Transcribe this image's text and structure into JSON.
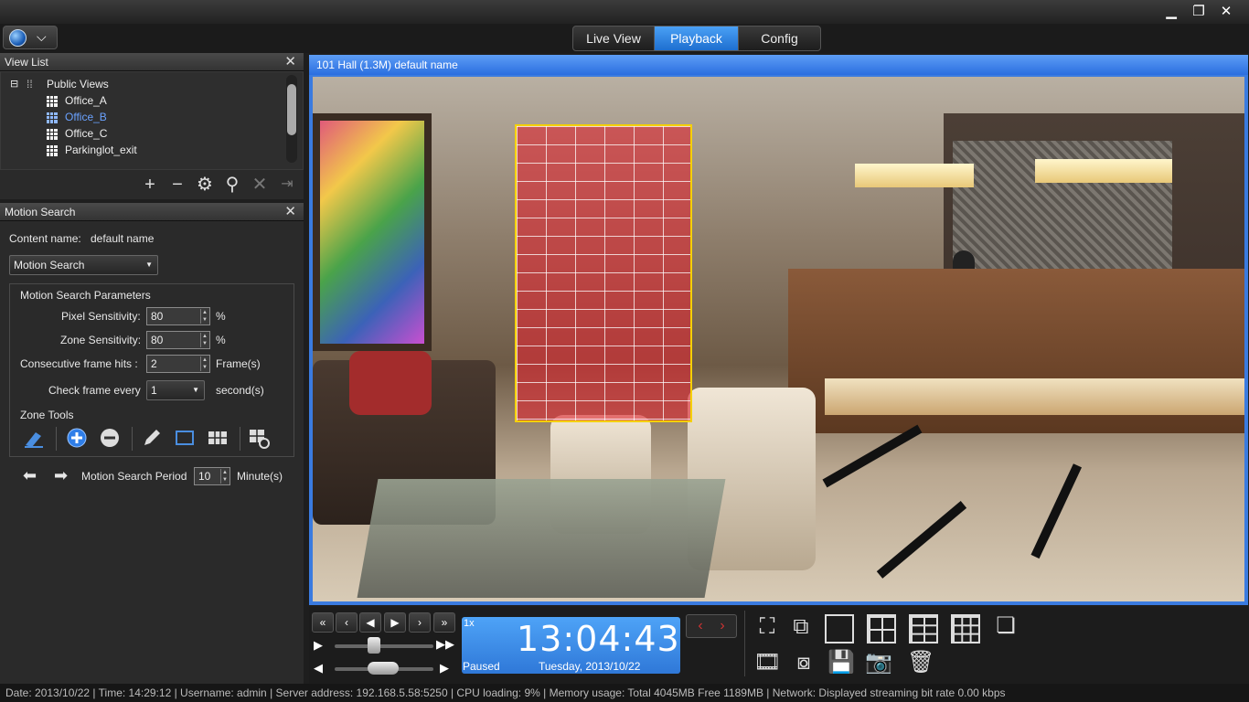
{
  "window": {
    "minimize": "▁",
    "restore": "❐",
    "close": "✕"
  },
  "tabs": [
    {
      "label": "Live View"
    },
    {
      "label": "Playback"
    },
    {
      "label": "Config"
    }
  ],
  "view_list": {
    "title": "View List",
    "root": "Public Views",
    "items": [
      "Office_A",
      "Office_B",
      "Office_C",
      "Parkinglot_exit"
    ],
    "selected": "Office_B"
  },
  "motion_search": {
    "title": "Motion Search",
    "content_name_label": "Content name:",
    "content_name_value": "default name",
    "mode": "Motion Search",
    "params_title": "Motion Search Parameters",
    "pixel_sensitivity_label": "Pixel Sensitivity:",
    "pixel_sensitivity": "80",
    "zone_sensitivity_label": "Zone Sensitivity:",
    "zone_sensitivity": "80",
    "percent": "%",
    "consecutive_label": "Consecutive frame hits :",
    "consecutive": "2",
    "frames_unit": "Frame(s)",
    "check_label": "Check frame every",
    "check_value": "1",
    "seconds_unit": "second(s)",
    "zone_tools_label": "Zone Tools",
    "period_label": "Motion Search Period",
    "period_value": "10",
    "period_unit": "Minute(s)"
  },
  "video": {
    "title": "101  Hall (1.3M)  default name"
  },
  "playback": {
    "speed": "1x",
    "time": "13:04:43",
    "status": "Paused",
    "date": "Tuesday, 2013/10/22"
  },
  "status_bar": "Date: 2013/10/22  |  Time: 14:29:12  |  Username: admin  |  Server address: 192.168.5.58:5250  |  CPU loading: 9%  |  Memory usage: Total 4045MB  Free 1189MB  |  Network: Displayed streaming bit rate      0.00 kbps"
}
